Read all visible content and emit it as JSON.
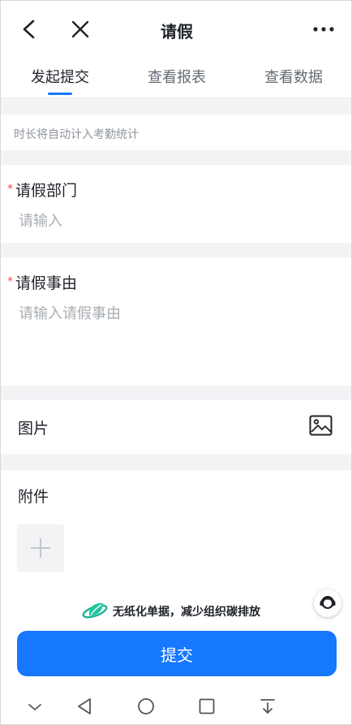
{
  "header": {
    "title": "请假"
  },
  "tabs": [
    {
      "label": "发起提交",
      "active": true
    },
    {
      "label": "查看报表",
      "active": false
    },
    {
      "label": "查看数据",
      "active": false
    }
  ],
  "form": {
    "duration_hint": "时长将自动计入考勤统计",
    "department": {
      "label": "请假部门",
      "required_mark": "*",
      "placeholder": "请输入"
    },
    "reason": {
      "label": "请假事由",
      "required_mark": "*",
      "placeholder": "请输入请假事由"
    },
    "image": {
      "label": "图片"
    },
    "attachment": {
      "label": "附件"
    }
  },
  "footer": {
    "slogan": "无纸化单据，减少组织碳排放",
    "submit_label": "提交"
  },
  "colors": {
    "accent": "#1677ff",
    "required": "#f54a45",
    "placeholder": "#a8adb3"
  }
}
